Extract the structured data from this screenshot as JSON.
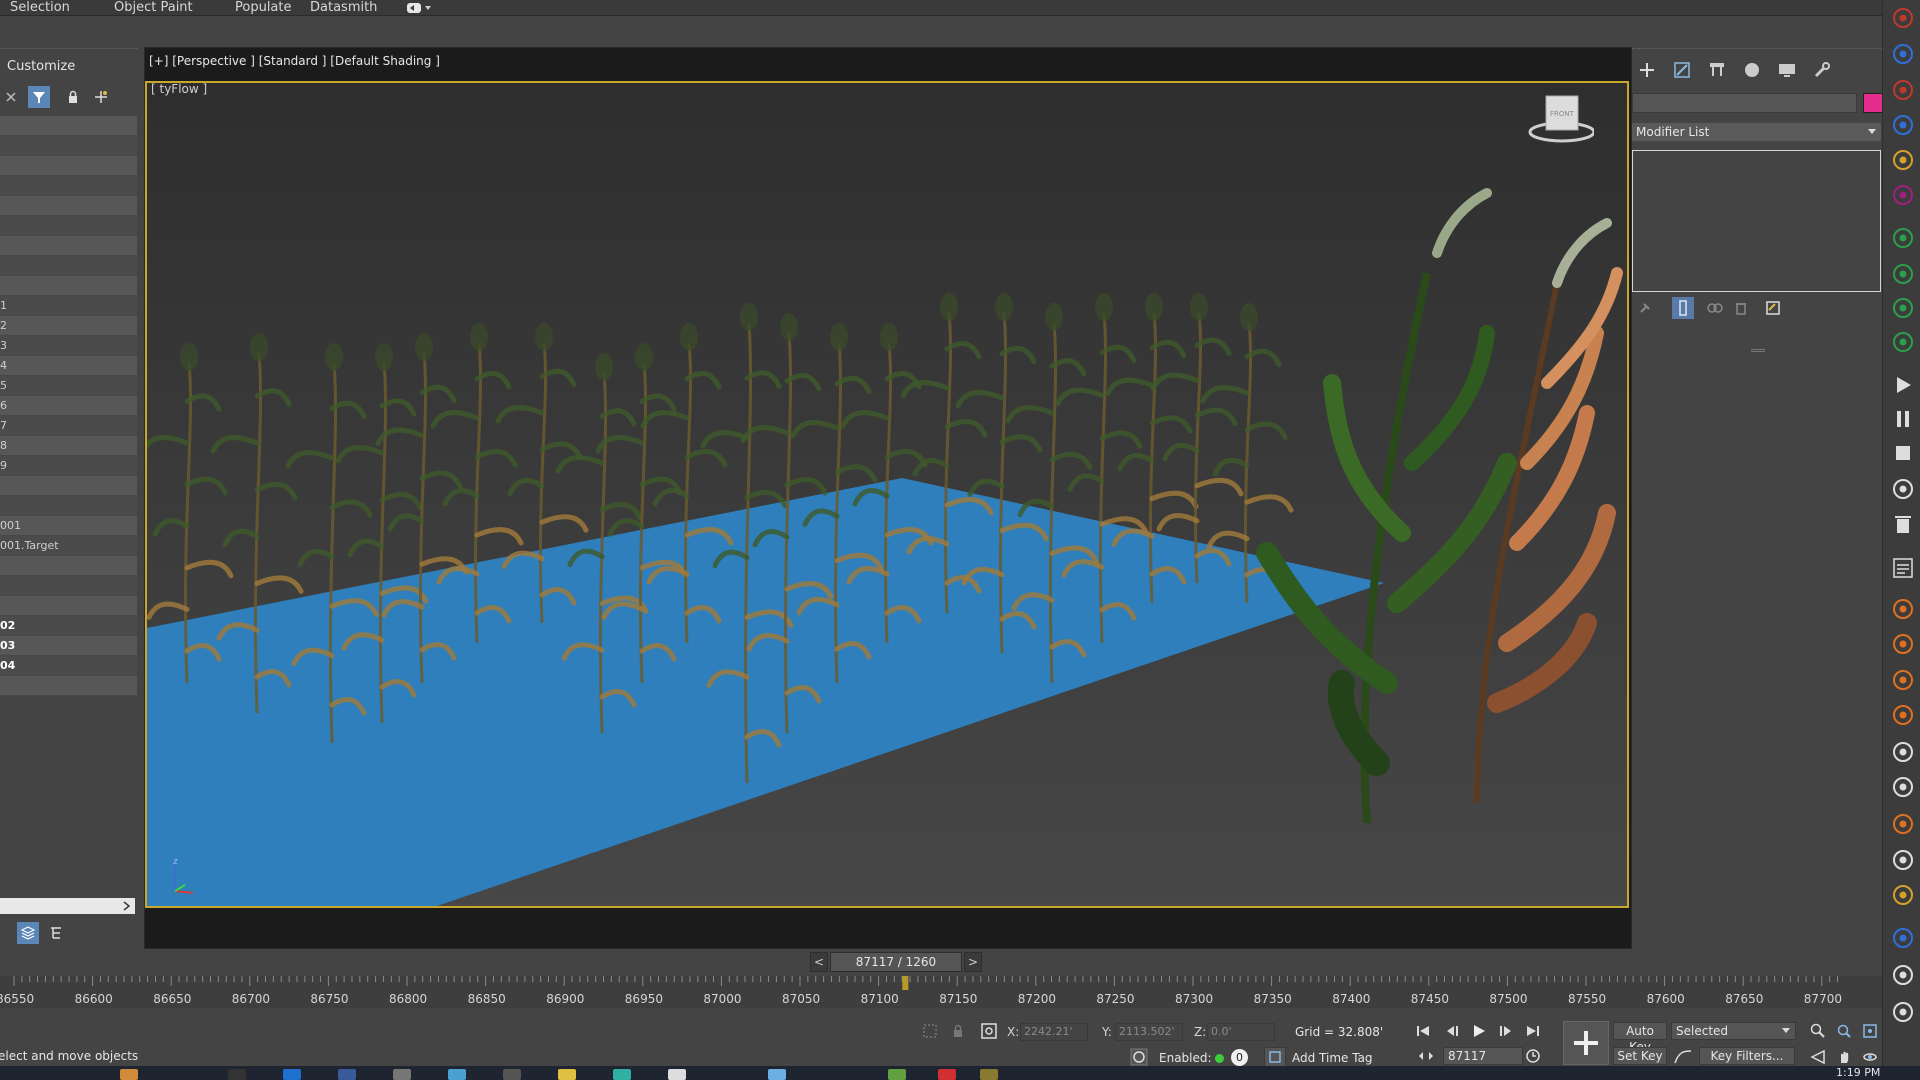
{
  "menu": {
    "items": [
      "Selection",
      "Object Paint",
      "Populate",
      "Datasmith"
    ]
  },
  "scene_explorer": {
    "title": "Customize",
    "rows": [
      {
        "label": "",
        "bold": false
      },
      {
        "label": "",
        "bold": false
      },
      {
        "label": "",
        "bold": false
      },
      {
        "label": "",
        "bold": false
      },
      {
        "label": "",
        "bold": false
      },
      {
        "label": "",
        "bold": false
      },
      {
        "label": "",
        "bold": false
      },
      {
        "label": "",
        "bold": false
      },
      {
        "label": "",
        "bold": false
      },
      {
        "label": "1",
        "bold": false
      },
      {
        "label": "2",
        "bold": false
      },
      {
        "label": "3",
        "bold": false
      },
      {
        "label": "4",
        "bold": false
      },
      {
        "label": "5",
        "bold": false
      },
      {
        "label": "6",
        "bold": false
      },
      {
        "label": "7",
        "bold": false
      },
      {
        "label": "8",
        "bold": false
      },
      {
        "label": "9",
        "bold": false
      },
      {
        "label": "",
        "bold": false
      },
      {
        "label": "",
        "bold": false
      },
      {
        "label": "001",
        "bold": false
      },
      {
        "label": "001.Target",
        "bold": false
      },
      {
        "label": "",
        "bold": false
      },
      {
        "label": "",
        "bold": false
      },
      {
        "label": "",
        "bold": false
      },
      {
        "label": "02",
        "bold": true
      },
      {
        "label": "03",
        "bold": true
      },
      {
        "label": "04",
        "bold": true
      },
      {
        "label": "",
        "bold": false
      }
    ]
  },
  "viewport": {
    "label": "[+] [Perspective ] [Standard ] [Default Shading ]",
    "sublabel": "[ tyFlow ]",
    "viewcube_text": "FRONT",
    "axis_label": "z"
  },
  "command_panel": {
    "modifier_list": "Modifier List",
    "color": "#e22d8a"
  },
  "timeline": {
    "frame_display": "87117 / 1260",
    "tick_labels": [
      "86550",
      "86600",
      "86650",
      "86700",
      "86750",
      "86800",
      "86850",
      "86900",
      "86950",
      "87000",
      "87050",
      "87100",
      "87150",
      "87200",
      "87250",
      "87300",
      "87350",
      "87400",
      "87450",
      "87500",
      "87550",
      "87600",
      "87650",
      "87700"
    ],
    "current_frame": 87117
  },
  "status": {
    "prompt": "elect and move objects",
    "x_label": "X:",
    "x_value": "2242.21'",
    "y_label": "Y:",
    "y_value": "2113.502'",
    "z_label": "Z:",
    "z_value": "0.0'",
    "grid": "Grid = 32.808'",
    "enabled_label": "Enabled:",
    "enabled_count": "0",
    "add_time_tag": "Add Time Tag",
    "current_frame_field": "87117",
    "auto_key": "Auto Key",
    "set_key": "Set Key",
    "selected": "Selected",
    "key_filters": "Key Filters..."
  },
  "taskbar": {
    "clock": "1:19 PM"
  }
}
